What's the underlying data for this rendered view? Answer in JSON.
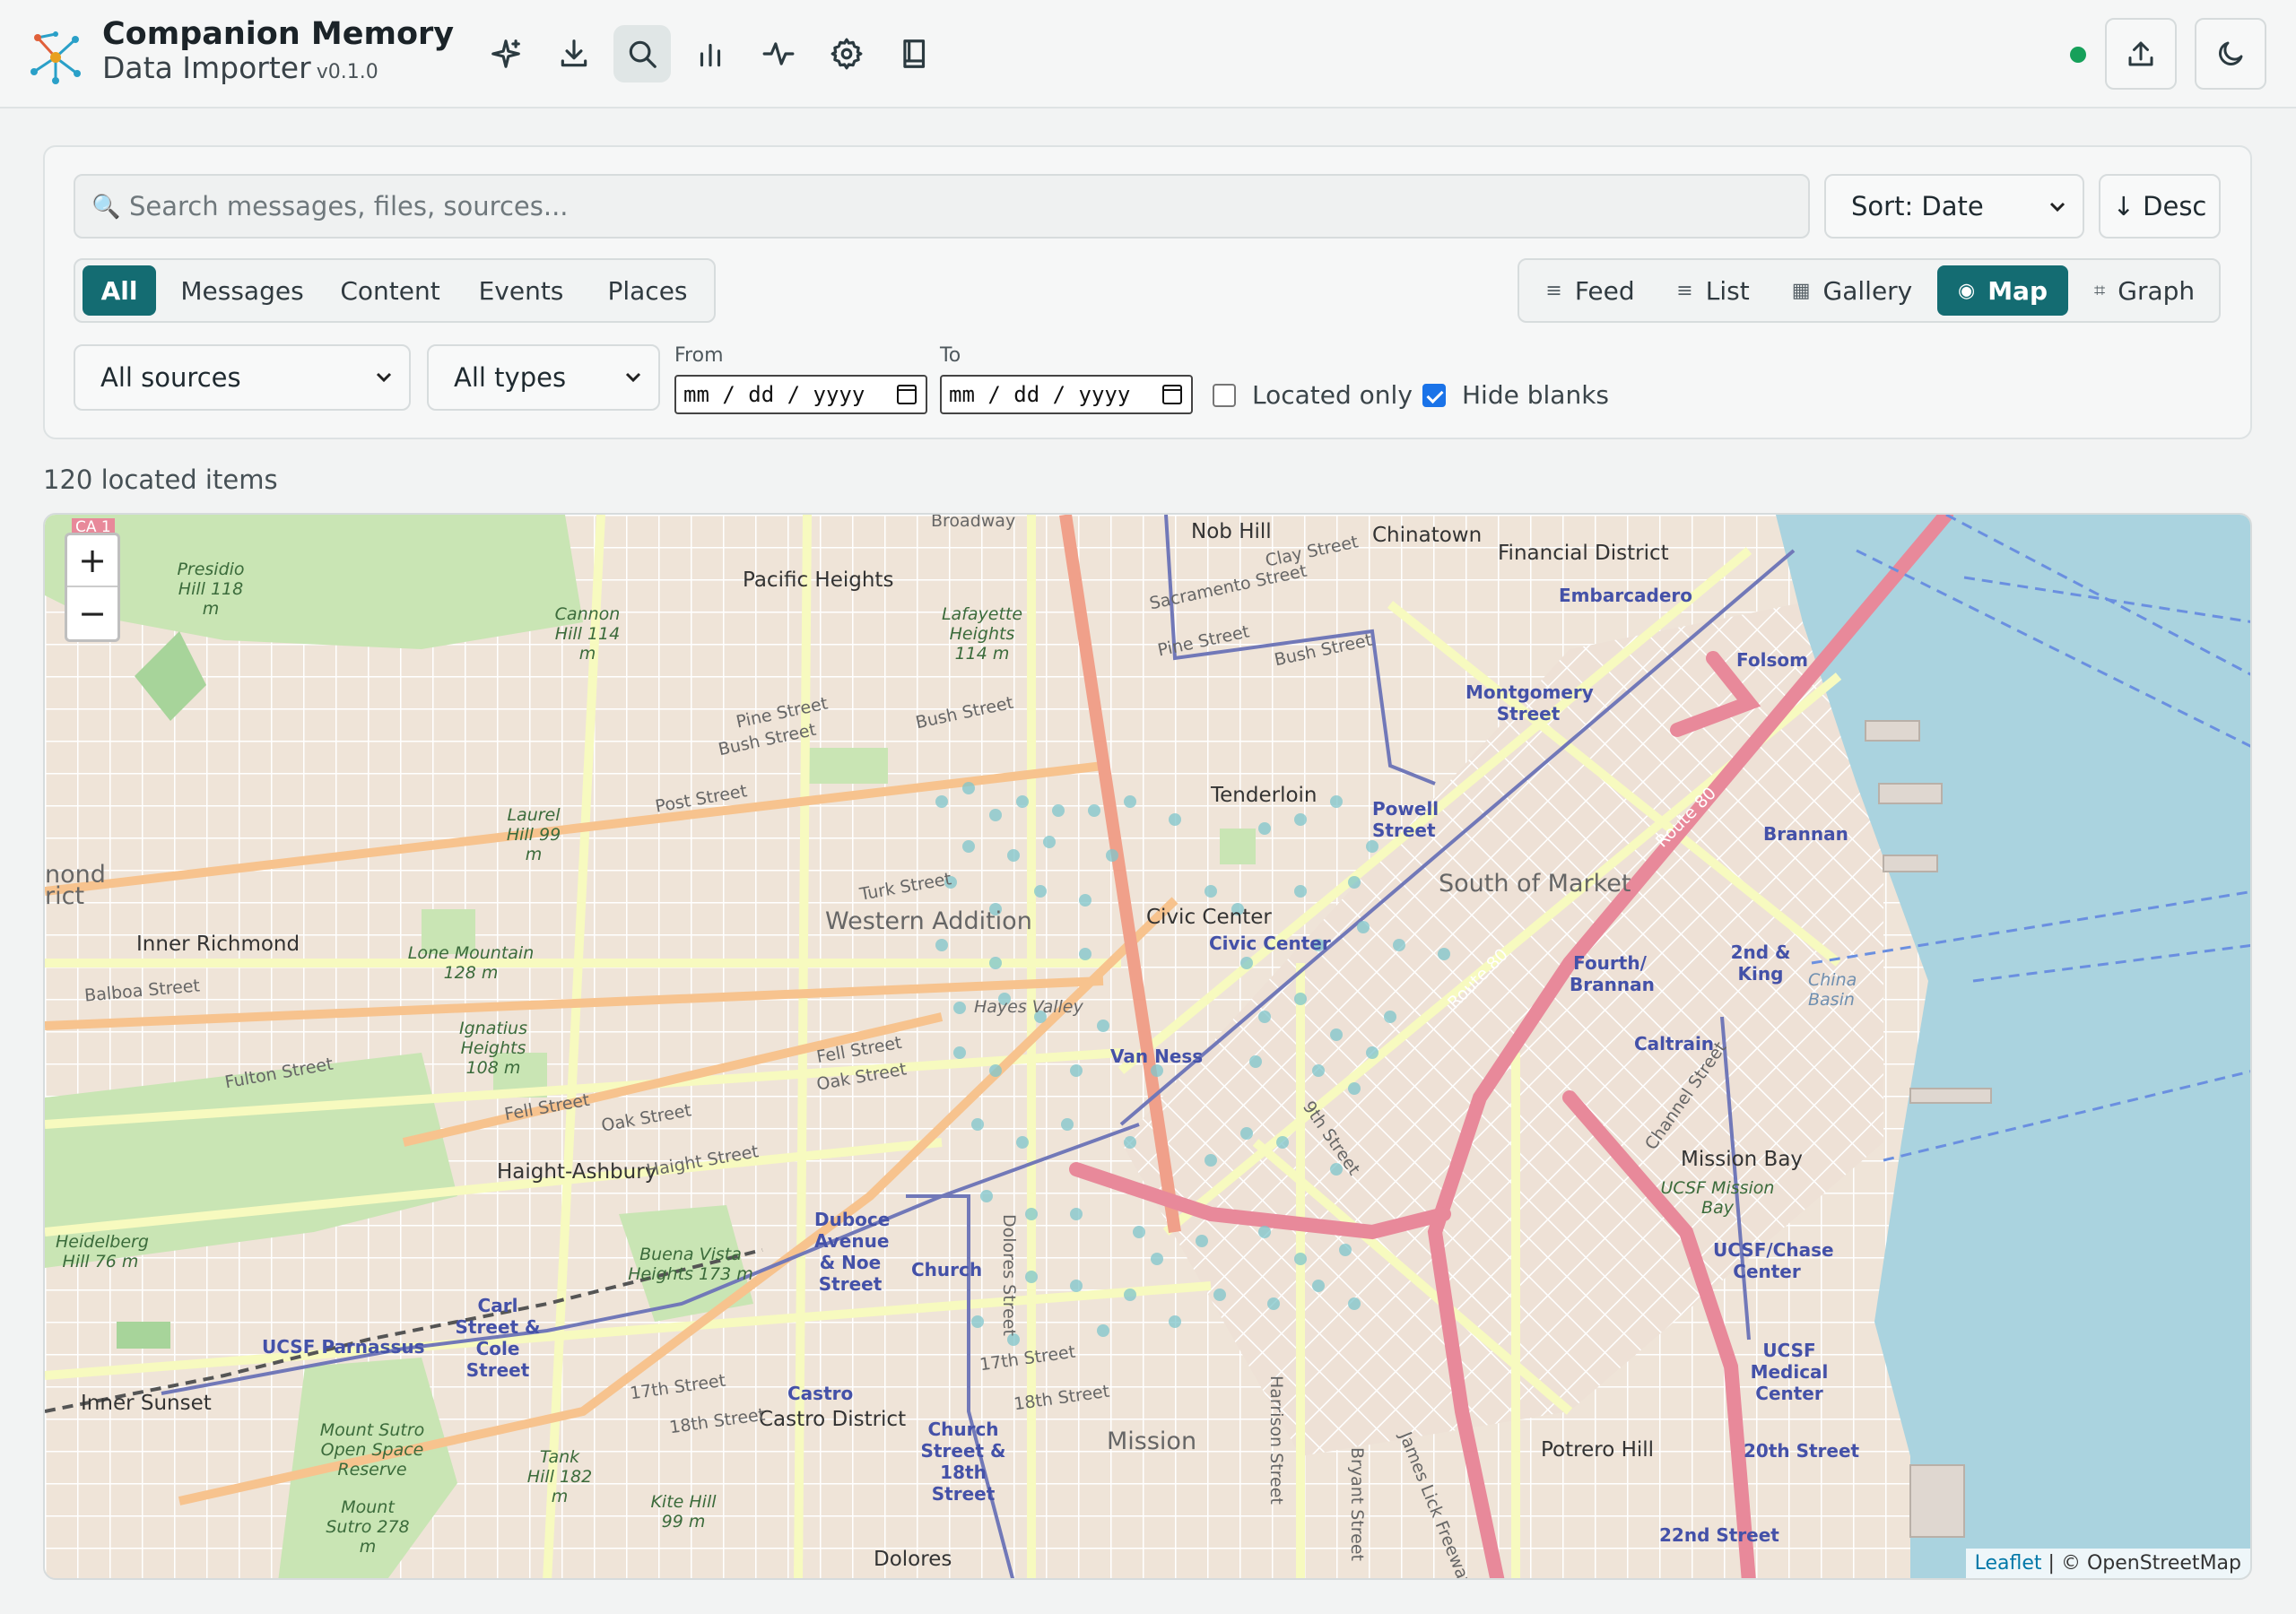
{
  "app": {
    "name": "Companion Memory",
    "subtitle": "Data Importer",
    "version": "v0.1.0"
  },
  "toolbar": {
    "icons": [
      "sparkle-icon",
      "download-icon",
      "search-icon",
      "bar-chart-icon",
      "activity-icon",
      "gear-icon",
      "book-icon"
    ],
    "active": "search-icon",
    "status_color": "#16a05a",
    "right_buttons": [
      "upload-icon",
      "moon-icon"
    ]
  },
  "filters": {
    "search_placeholder": "Search messages, files, sources...",
    "sort_label": "Sort: Date",
    "order_label": "↓ Desc",
    "categories": [
      "All",
      "Messages",
      "Content",
      "Events",
      "Places"
    ],
    "active_category": "All",
    "views": [
      {
        "label": "Feed",
        "glyph": "≡"
      },
      {
        "label": "List",
        "glyph": "≡"
      },
      {
        "label": "Gallery",
        "glyph": "▦"
      },
      {
        "label": "Map",
        "glyph": "◉"
      },
      {
        "label": "Graph",
        "glyph": "⌗"
      }
    ],
    "active_view": "Map",
    "source_select": "All sources",
    "type_select": "All types",
    "from_label": "From",
    "to_label": "To",
    "from_value": "mm / dd / yyyy",
    "to_value": "mm / dd / yyyy",
    "located_only_label": "Located only",
    "located_only": false,
    "hide_blanks_label": "Hide blanks",
    "hide_blanks": true
  },
  "results": {
    "count_text": "120 located items"
  },
  "map": {
    "zoom_in": "+",
    "zoom_out": "−",
    "attribution_link": "Leaflet",
    "attribution_text": " | © OpenStreetMap",
    "water_color": "#aad3df",
    "labels": {
      "broadway": "Broadway",
      "nob_hill": "Nob Hill",
      "chinatown": "Chinatown",
      "financial_district": "Financial District",
      "embarcadero": "Embarcadero",
      "presidio_hill": "Presidio Hill 118 m",
      "pacific_heights": "Pacific Heights",
      "lafayette_heights": "Lafayette Heights 114 m",
      "cannon_hill": "Cannon Hill 114 m",
      "clay_street": "Clay Street",
      "sacramento_street": "Sacramento Street",
      "pine_street": "Pine Street",
      "bush_street": "Bush Street",
      "folsom": "Folsom",
      "montgomery_street": "Montgomery Street",
      "tenderloin": "Tenderloin",
      "powell_street": "Powell Street",
      "brannan": "Brannan",
      "south_of_market": "South of Market",
      "laurel_hill": "Laurel Hill 99 m",
      "post_street": "Post Street",
      "turk_street": "Turk Street",
      "western_addition": "Western Addition",
      "civic_center": "Civic Center",
      "civic_center_station": "Civic Center",
      "inner_richmond": "Inner Richmond",
      "lone_mountain": "Lone Mountain 128 m",
      "balboa_street": "Balboa Street",
      "fourth_brannan": "Fourth/ Brannan",
      "second_king": "2nd & King",
      "china_basin": "China Basin",
      "hayes_valley": "Hayes Valley",
      "ignatius_heights": "Ignatius Heights 108 m",
      "fulton_street": "Fulton Street",
      "fell_street": "Fell Street",
      "oak_street": "Oak Street",
      "van_ness": "Van Ness",
      "caltrain": "Caltrain",
      "haight_ashbury": "Haight-Ashbury",
      "haight_street": "Haight Street",
      "mission_bay": "Mission Bay",
      "ucsf_mission_bay": "UCSF Mission Bay",
      "heidelberg_hill": "Heidelberg Hill 76 m",
      "duboce": "Duboce Avenue & Noe Street",
      "church": "Church",
      "buena_vista": "Buena Vista Heights 173 m",
      "ucsf_chase": "UCSF/Chase Center",
      "carl_cole": "Carl Street & Cole Street",
      "ucsf_parnassus": "UCSF Parnassus",
      "seventeenth": "17th Street",
      "castro": "Castro",
      "castro_district": "Castro District",
      "eighteenth": "18th Street",
      "ucsf_medical": "UCSF Medical Center",
      "inner_sunset": "Inner Sunset",
      "mount_sutro": "Mount Sutro Open Space Reserve",
      "tank_hill": "Tank Hill 182 m",
      "church_18th": "Church Street & 18th Street",
      "mission": "Mission",
      "potrero_hill": "Potrero Hill",
      "twentieth": "20th Street",
      "mount_sutro_peak": "Mount Sutro 278 m",
      "kite_hill": "Kite Hill 99 m",
      "dolores": "Dolores",
      "twenty_second": "22nd Street",
      "harrison_street": "Harrison Street",
      "bryant_street": "Bryant Street",
      "dolores_street": "Dolores Street",
      "james_lick": "James Lick Freeway",
      "ninth_street": "9th Street",
      "channel_street": "Channel Street",
      "route_80": "Route 80",
      "richmond_district": "nond rict",
      "ca1": "CA 1"
    }
  }
}
